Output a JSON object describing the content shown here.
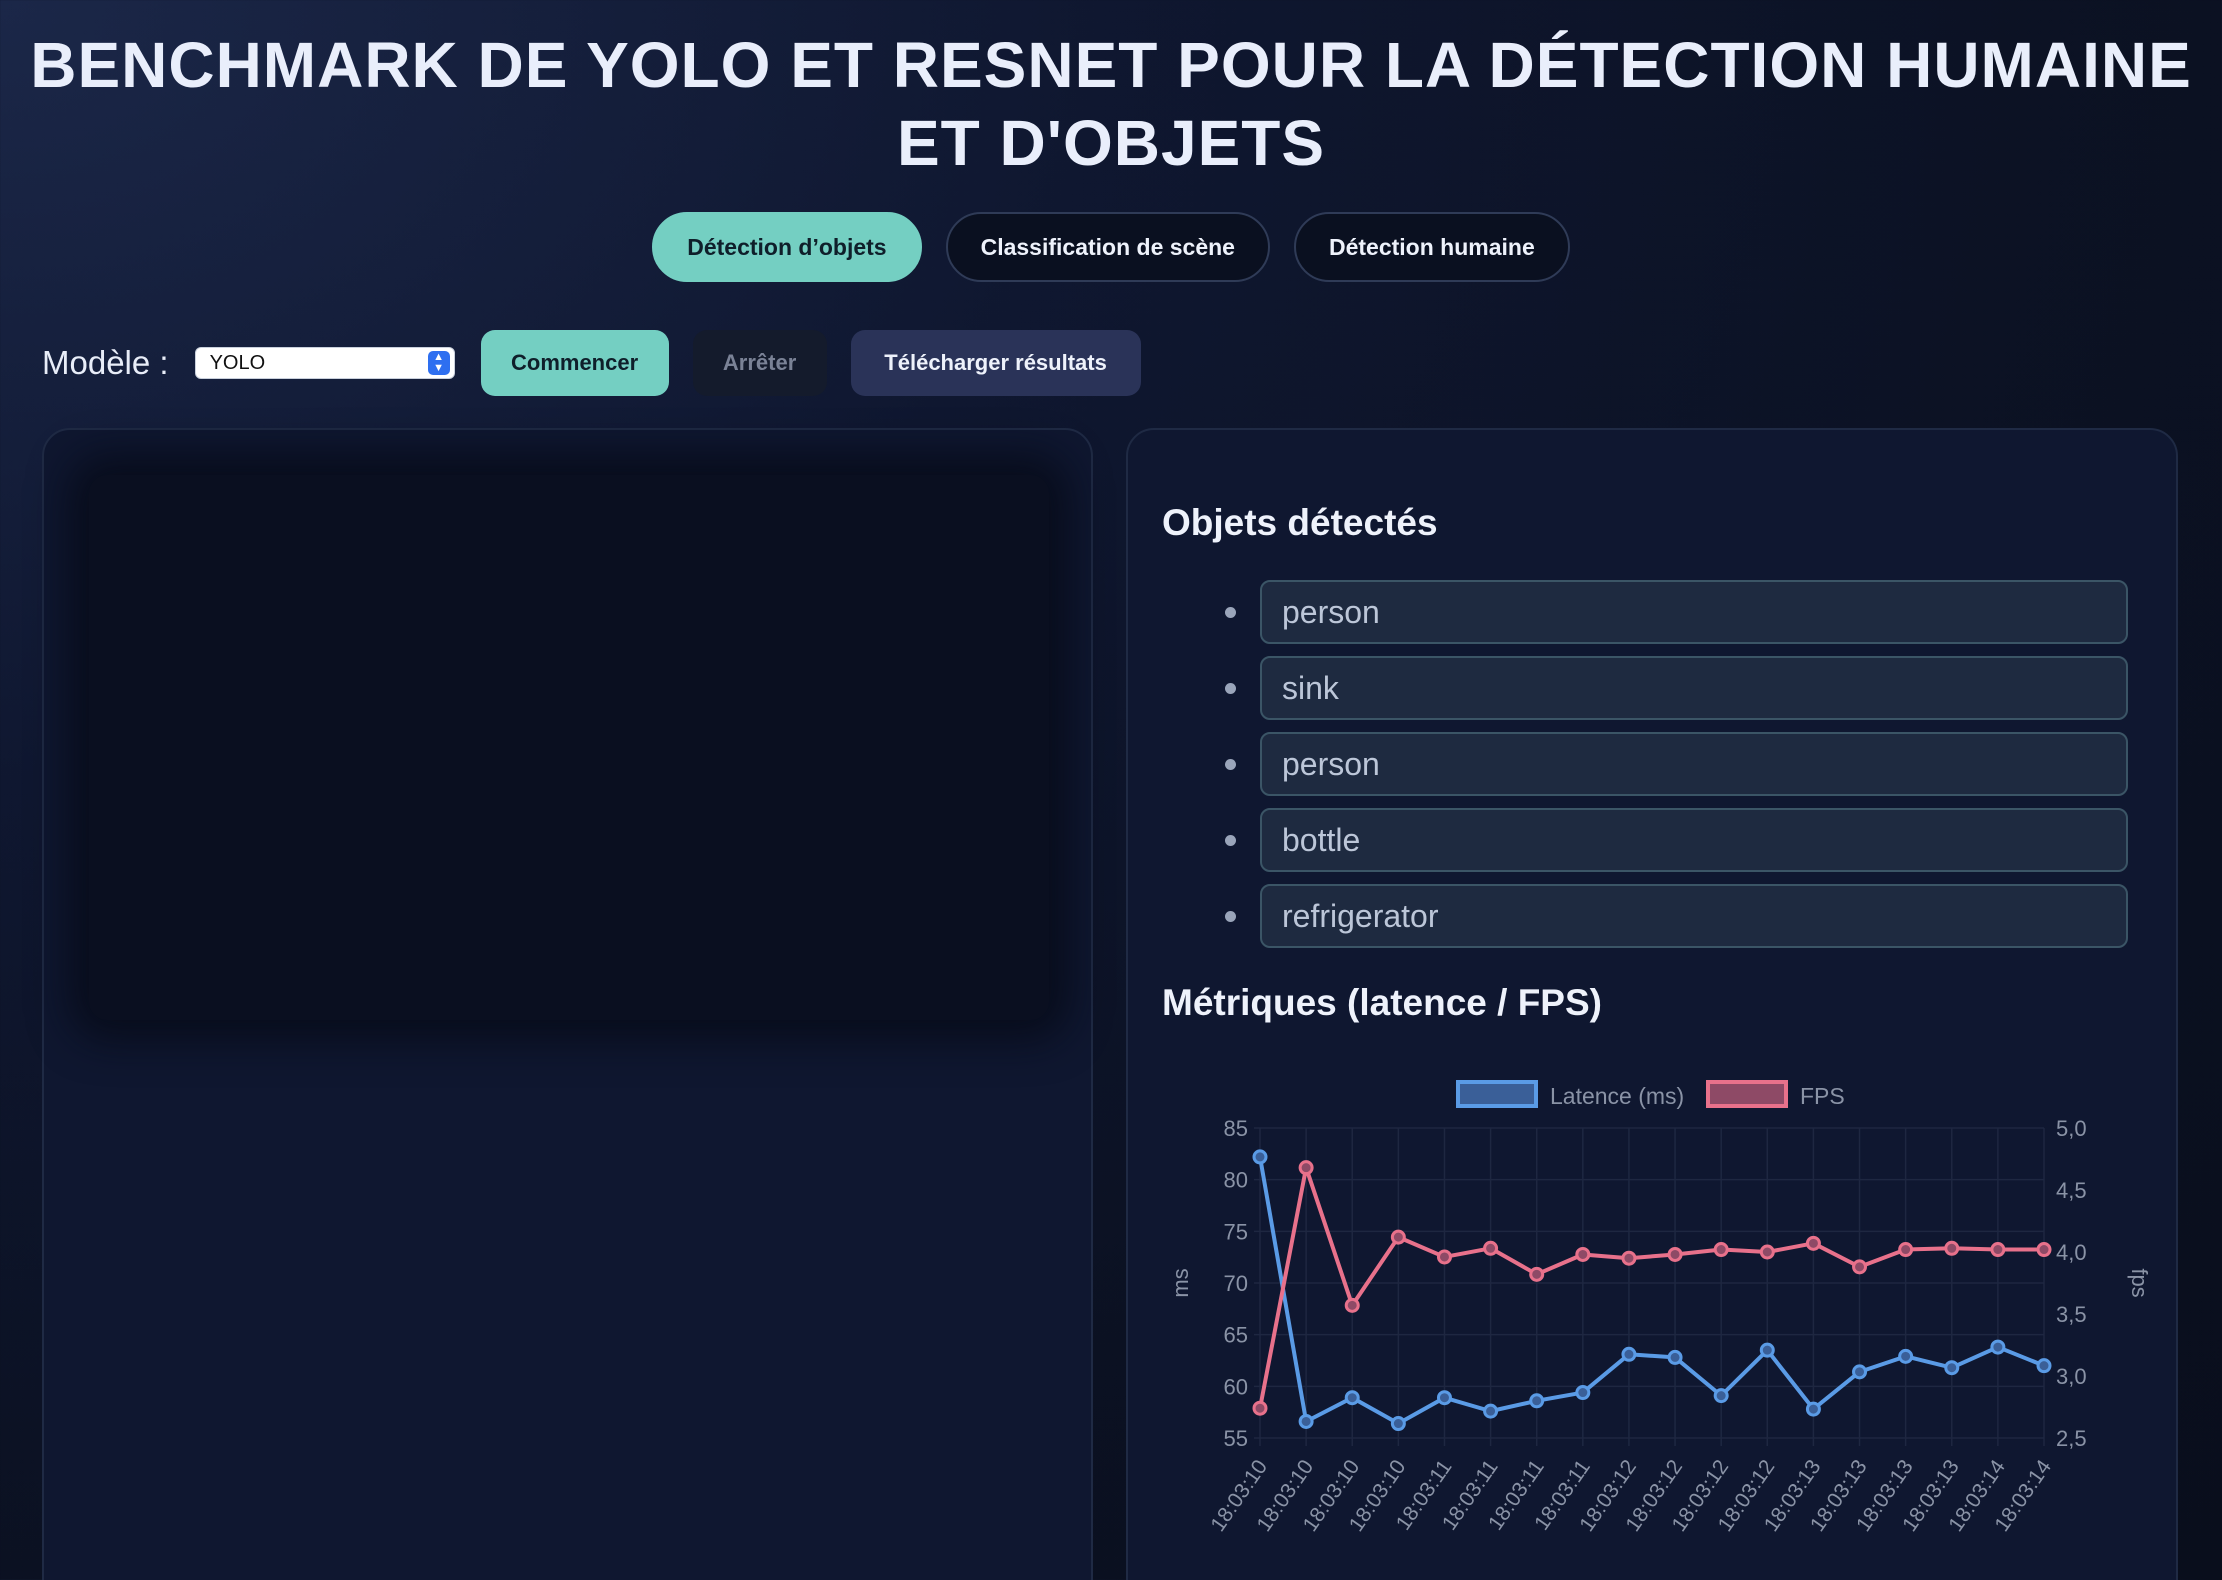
{
  "header": {
    "title_line1": "BENCHMARK DE YOLO ET RESNET POUR LA DÉTECTION HUMAINE",
    "title_line2": "ET D'OBJETS"
  },
  "tabs": [
    {
      "label": "Détection d’objets",
      "active": true
    },
    {
      "label": "Classification de scène",
      "active": false
    },
    {
      "label": "Détection humaine",
      "active": false
    }
  ],
  "toolbar": {
    "model_label": "Modèle :",
    "model_value": "YOLO",
    "start_label": "Commencer",
    "stop_label": "Arrêter",
    "download_label": "Télécharger résultats"
  },
  "detected": {
    "heading": "Objets détectés",
    "items": [
      "person",
      "sink",
      "person",
      "bottle",
      "refrigerator"
    ]
  },
  "metrics": {
    "heading": "Métriques (latence / FPS)"
  },
  "colors": {
    "accent": "#74cfc2",
    "latency": "#5a9be6",
    "fps": "#e8718b"
  },
  "chart_data": {
    "type": "line",
    "x": [
      "18:03:10",
      "18:03:10",
      "18:03:10",
      "18:03:10",
      "18:03:11",
      "18:03:11",
      "18:03:11",
      "18:03:11",
      "18:03:12",
      "18:03:12",
      "18:03:12",
      "18:03:12",
      "18:03:13",
      "18:03:13",
      "18:03:13",
      "18:03:13",
      "18:03:14",
      "18:03:14"
    ],
    "series": [
      {
        "name": "Latence (ms)",
        "axis": "left",
        "color": "#5a9be6",
        "values": [
          82.2,
          56.6,
          58.9,
          56.4,
          58.9,
          57.6,
          58.6,
          59.4,
          63.1,
          62.8,
          59.1,
          63.5,
          57.8,
          61.4,
          62.9,
          61.8,
          63.8,
          62.0
        ]
      },
      {
        "name": "FPS",
        "axis": "right",
        "color": "#e8718b",
        "values": [
          2.74,
          4.68,
          3.57,
          4.12,
          3.96,
          4.03,
          3.82,
          3.98,
          3.95,
          3.98,
          4.02,
          4.0,
          4.07,
          3.88,
          4.02,
          4.03,
          4.02,
          4.02
        ]
      }
    ],
    "ylabel": "ms",
    "ylim": [
      55,
      85
    ],
    "yticks": [
      "85",
      "80",
      "75",
      "70",
      "65",
      "60",
      "55"
    ],
    "ylabel_right": "fps",
    "ylim_right": [
      2.5,
      5.0
    ],
    "yticks_right": [
      "5,0",
      "4,5",
      "4,0",
      "3,5",
      "3,0",
      "2,5"
    ],
    "grid": true,
    "legend": "top"
  }
}
